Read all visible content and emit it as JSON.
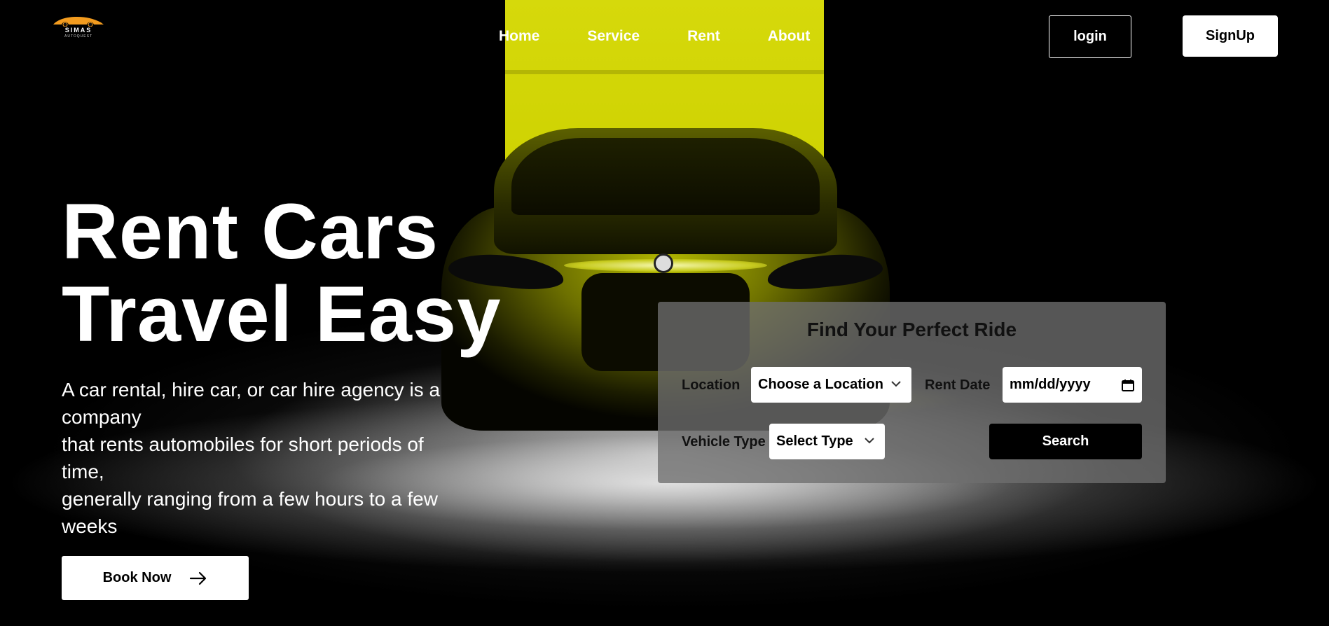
{
  "brand": {
    "name": "SIMAS",
    "tagline": "AUTOQUEST",
    "accent_color": "#f39c1f"
  },
  "nav": {
    "items": [
      "Home",
      "Service",
      "Rent",
      "About"
    ]
  },
  "auth": {
    "login_label": "login",
    "signup_label": "SignUp"
  },
  "hero": {
    "title_line1": "Rent Cars",
    "title_line2": "Travel Easy",
    "description_lines": [
      "A car rental, hire car, or car hire agency is a",
      "company",
      "that rents automobiles for short periods of",
      "time,",
      "generally ranging from a few hours to a few",
      "weeks"
    ],
    "book_label": "Book Now",
    "book_icon": "arrow-right-icon"
  },
  "search_panel": {
    "title": "Find Your Perfect Ride",
    "location_label": "Location",
    "location_value": "Choose a Location",
    "date_label": "Rent Date",
    "date_placeholder": "mm/dd/yyyy",
    "vehicle_label": "Vehicle Type",
    "vehicle_value": "Select Type",
    "search_label": "Search"
  },
  "colors": {
    "beam": "#cdd100",
    "panel": "rgba(110,110,110,0.78)"
  }
}
